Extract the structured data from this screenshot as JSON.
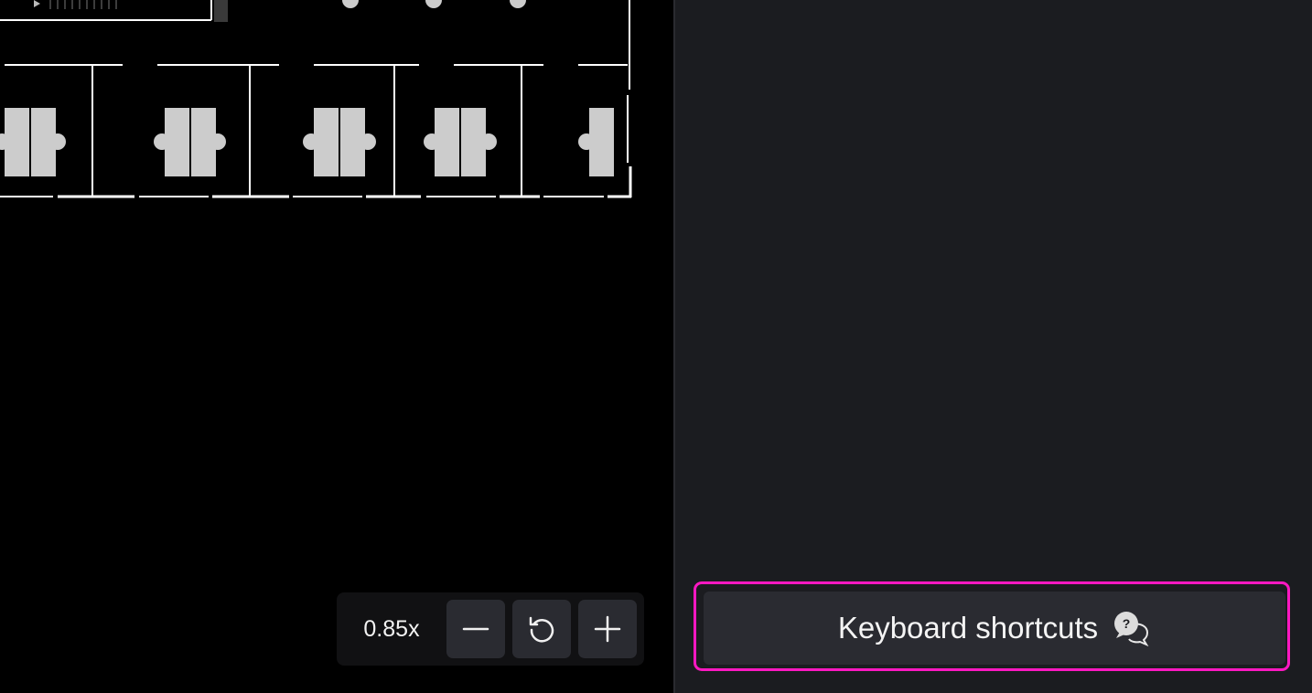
{
  "zoom": {
    "value_label": "0.85x",
    "zoom_out_icon": "minus-icon",
    "reset_icon": "reset-rotate-icon",
    "zoom_in_icon": "plus-icon"
  },
  "side_panel": {
    "shortcuts_label": "Keyboard shortcuts",
    "shortcuts_icon": "help-chat-icon",
    "highlight_color": "#ff18c2"
  },
  "colors": {
    "canvas_bg": "#000000",
    "panel_bg": "#1b1c20",
    "button_bg": "#2a2b31",
    "desk_fill": "#cccccc",
    "wall_line": "#ffffff"
  }
}
